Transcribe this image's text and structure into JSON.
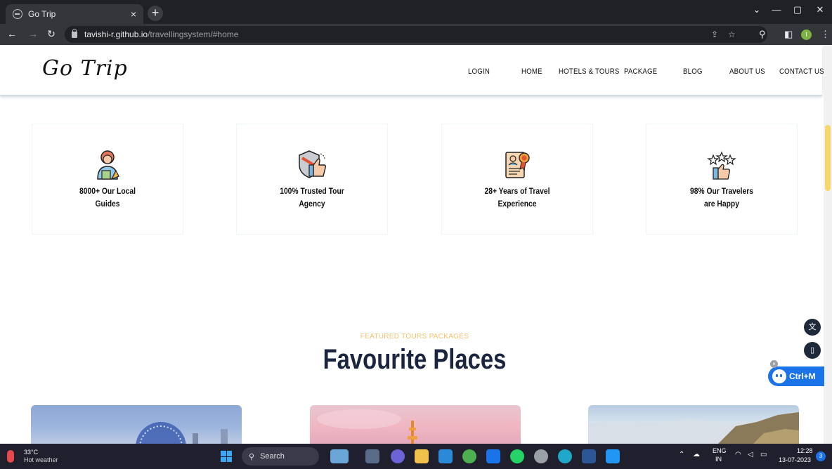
{
  "browser": {
    "tab_title": "Go Trip",
    "tab_close": "×",
    "new_tab": "+",
    "url_host": "tavishi-r.github.io",
    "url_path": "/travellingsystem/#home",
    "window_controls": {
      "tabsearch": "⌄",
      "minimize": "—",
      "maximize": "▢",
      "close": "✕"
    },
    "profile_initial": "I"
  },
  "site": {
    "logo": "Go Trip",
    "nav": [
      "LOGIN",
      "HOME",
      "HOTELS & TOURS",
      "PACKAGE",
      "BLOG",
      "ABOUT US",
      "CONTACT US"
    ]
  },
  "features": [
    {
      "line1": "8000+ Our Local",
      "line2": "Guides",
      "icon": "tour-guide-icon"
    },
    {
      "line1": "100% Trusted Tour",
      "line2": "Agency",
      "icon": "shield-thumb-icon"
    },
    {
      "line1": "28+ Years of Travel",
      "line2": "Experience",
      "icon": "certificate-icon"
    },
    {
      "line1": "98% Our Travelers",
      "line2": "are Happy",
      "icon": "stars-thumbs-up-icon"
    }
  ],
  "section": {
    "subtitle": "FEATURED TOURS PACKAGES",
    "title": "Favourite Places"
  },
  "widget": {
    "ctrlm_label": "Ctrl+M",
    "close": "×"
  },
  "taskbar": {
    "temperature": "33°C",
    "weather": "Hot weather",
    "search_label": "Search",
    "lang_top": "ENG",
    "lang_bottom": "IN",
    "time": "12:28",
    "date": "13-07-2023",
    "notification_count": "3"
  },
  "colors": {
    "accent": "#f5c16c",
    "title": "#1b2540",
    "scroll_thumb": "#f5d76e"
  }
}
